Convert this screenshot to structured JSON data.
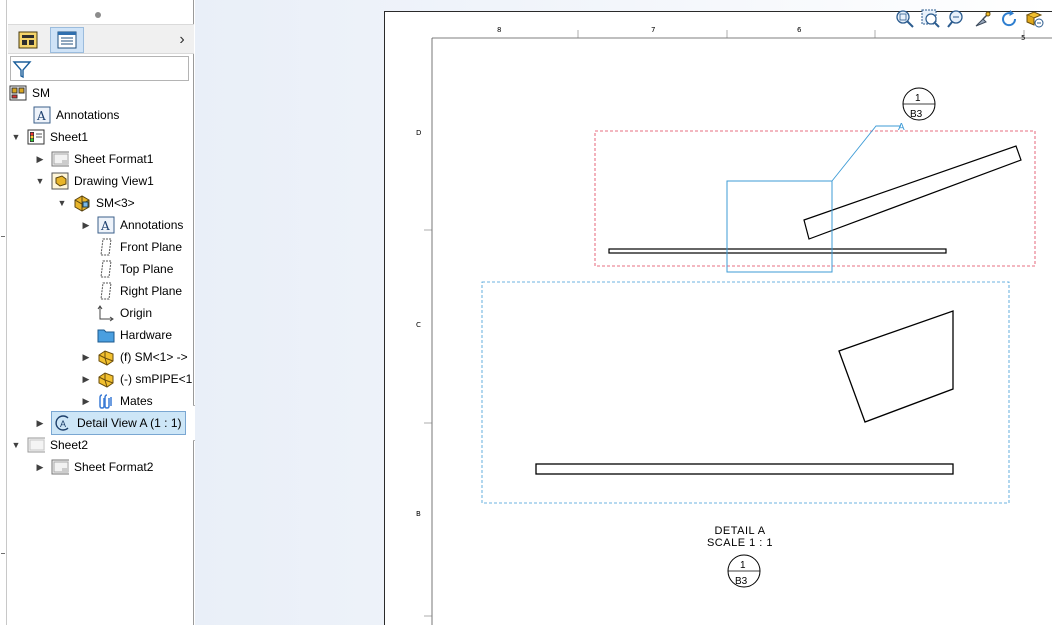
{
  "tree": {
    "root": "SM",
    "items": [
      {
        "label": "Annotations"
      },
      {
        "label": "Sheet1"
      },
      {
        "label": "Sheet Format1"
      },
      {
        "label": "Drawing View1"
      },
      {
        "label": "SM<3>"
      },
      {
        "label": "Annotations"
      },
      {
        "label": "Front Plane"
      },
      {
        "label": "Top Plane"
      },
      {
        "label": "Right Plane"
      },
      {
        "label": "Origin"
      },
      {
        "label": "Hardware"
      },
      {
        "label": "(f) SM<1> ->"
      },
      {
        "label": "(-) smPIPE<1"
      },
      {
        "label": "Mates"
      },
      {
        "label": "Detail View A (1 : 1)"
      },
      {
        "label": "Sheet2"
      },
      {
        "label": "Sheet Format2"
      }
    ]
  },
  "sheet": {
    "column_labels": [
      "8",
      "7",
      "6",
      "5"
    ],
    "row_labels": [
      "D",
      "C",
      "B"
    ],
    "detail_letter": "A",
    "detail_bubble": {
      "top": "1",
      "bottom": "B3"
    },
    "detail_caption_line1": "DETAIL A",
    "detail_caption_line2": "SCALE 1 : 1",
    "colors": {
      "selection_red": "#e0405a",
      "selection_blue": "#3d9bd6",
      "selected_row_bg": "#cde6f7"
    }
  },
  "icons": {
    "heads_up": [
      "zoom-to-fit-icon",
      "zoom-to-area-icon",
      "zoom-in-out-icon",
      "select-icon",
      "rotate-icon",
      "view-settings-icon"
    ]
  }
}
